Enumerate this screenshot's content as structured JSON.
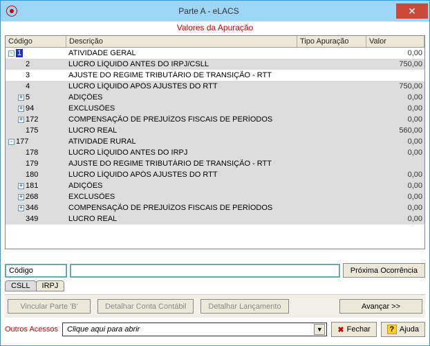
{
  "window": {
    "title": "Parte A - eLACS"
  },
  "subtitle": "Valores da Apuração",
  "columns": {
    "codigo": "Código",
    "descricao": "Descrição",
    "tipo": "Tipo Apuração",
    "valor": "Valor"
  },
  "rows": [
    {
      "indent": 0,
      "exp": "-",
      "code": "1",
      "desc": "ATIVIDADE GERAL",
      "valor": "0,00",
      "selected": true
    },
    {
      "indent": 1,
      "exp": "",
      "code": "2",
      "desc": "LUCRO LÍQUIDO ANTES DO IRPJ/CSLL",
      "valor": "750,00",
      "hl": true
    },
    {
      "indent": 1,
      "exp": "",
      "code": "3",
      "desc": "AJUSTE DO REGIME TRIBUTÁRIO DE TRANSIÇÃO - RTT",
      "valor": ""
    },
    {
      "indent": 1,
      "exp": "",
      "code": "4",
      "desc": "LUCRO LÍQUIDO APÓS AJUSTES DO RTT",
      "valor": "750,00",
      "hl": true
    },
    {
      "indent": 1,
      "exp": "+",
      "code": "5",
      "desc": "ADIÇÕES",
      "valor": "0,00",
      "hl": true
    },
    {
      "indent": 1,
      "exp": "+",
      "code": "94",
      "desc": "EXCLUSÕES",
      "valor": "0,00",
      "hl": true
    },
    {
      "indent": 1,
      "exp": "+",
      "code": "172",
      "desc": "COMPENSAÇÃO DE PREJUÍZOS FISCAIS DE PERÍODOS",
      "valor": "0,00",
      "hl": true
    },
    {
      "indent": 1,
      "exp": "",
      "code": "175",
      "desc": "LUCRO REAL",
      "valor": "560,00",
      "hl": true
    },
    {
      "indent": 0,
      "exp": "-",
      "code": "177",
      "desc": "ATIVIDADE RURAL",
      "valor": "0,00",
      "hl": true
    },
    {
      "indent": 1,
      "exp": "",
      "code": "178",
      "desc": "LUCRO LÍQUIDO ANTES DO IRPJ",
      "valor": "0,00",
      "hl": true
    },
    {
      "indent": 1,
      "exp": "",
      "code": "179",
      "desc": "AJUSTE DO REGIME TRIBUTÁRIO DE TRANSIÇÃO - RTT",
      "valor": "",
      "hl": true
    },
    {
      "indent": 1,
      "exp": "",
      "code": "180",
      "desc": "LUCRO LÍQUIDO APÓS AJUSTES DO RTT",
      "valor": "0,00",
      "hl": true
    },
    {
      "indent": 1,
      "exp": "+",
      "code": "181",
      "desc": "ADIÇÕES",
      "valor": "0,00",
      "hl": true
    },
    {
      "indent": 1,
      "exp": "+",
      "code": "268",
      "desc": "EXCLUSÕES",
      "valor": "0,00",
      "hl": true
    },
    {
      "indent": 1,
      "exp": "+",
      "code": "346",
      "desc": "COMPENSAÇÃO DE PREJUÍZOS FISCAIS DE PERÍODOS",
      "valor": "0,00",
      "hl": true
    },
    {
      "indent": 1,
      "exp": "",
      "code": "349",
      "desc": "LUCRO REAL",
      "valor": "0,00",
      "hl": true
    }
  ],
  "search": {
    "label": "Código",
    "value": "",
    "button": "Próxima Ocorrência"
  },
  "tabs": {
    "csll": "CSLL",
    "irpj": "IRPJ"
  },
  "actions": {
    "vincular": "Vincular Parte 'B'",
    "detalharConta": "Detalhar Conta Contábil",
    "detalharLanc": "Detalhar Lançamento",
    "avancar": "Avançar >>"
  },
  "footer": {
    "outros": "Outros Acessos",
    "combo": "Clique aqui para abrir",
    "fechar": "Fechar",
    "ajuda": "Ajuda"
  }
}
